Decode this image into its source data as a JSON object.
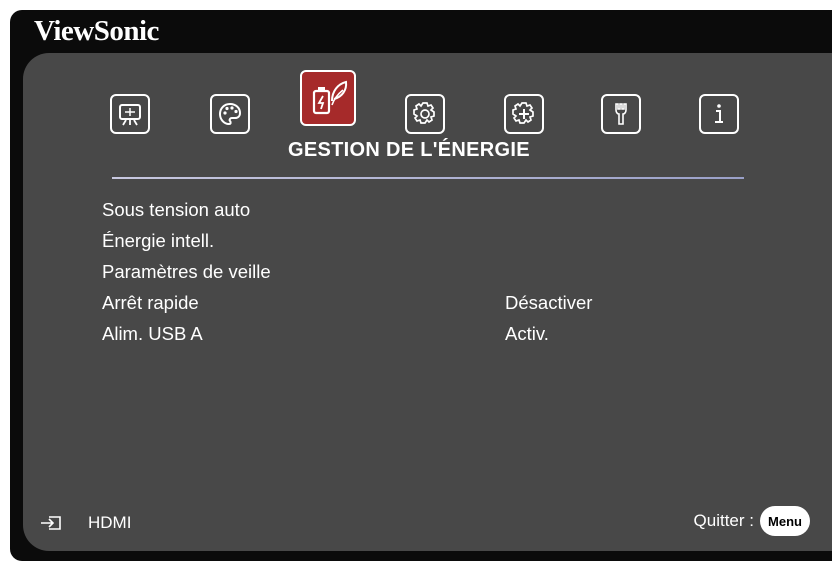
{
  "brand": "ViewSonic",
  "tabs": [
    {
      "name": "display",
      "icon": "display-icon",
      "active": false
    },
    {
      "name": "image",
      "icon": "palette-icon",
      "active": false
    },
    {
      "name": "power-management",
      "icon": "power-leaf-icon",
      "active": true
    },
    {
      "name": "basic",
      "icon": "gear-icon",
      "active": false
    },
    {
      "name": "advanced",
      "icon": "advanced-gear-icon",
      "active": false
    },
    {
      "name": "system",
      "icon": "wrench-icon",
      "active": false
    },
    {
      "name": "information",
      "icon": "info-icon",
      "active": false
    }
  ],
  "section_title": "GESTION DE L'ÉNERGIE",
  "menu": [
    {
      "label": "Sous tension auto",
      "value": ""
    },
    {
      "label": "Énergie intell.",
      "value": ""
    },
    {
      "label": "Paramètres de veille",
      "value": ""
    },
    {
      "label": "Arrêt rapide",
      "value": "Désactiver"
    },
    {
      "label": "Alim. USB A",
      "value": "Activ."
    }
  ],
  "footer": {
    "source_icon": "input-source-icon",
    "source_label": "HDMI",
    "quit_label": "Quitter :",
    "menu_button": "Menu"
  },
  "colors": {
    "active_tab": "#a62a2a",
    "panel": "#484848",
    "frame": "#0b0b0b"
  }
}
